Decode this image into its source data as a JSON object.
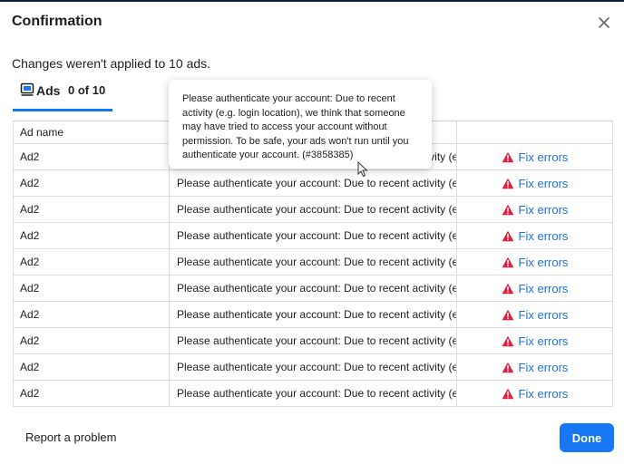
{
  "colors": {
    "accent": "#1877f2",
    "link": "#216fdb",
    "error": "#e41e3f",
    "header_band": "#0d1f33"
  },
  "dialog": {
    "title": "Confirmation",
    "close_icon": "close-icon",
    "subtitle": "Changes weren't applied to 10 ads."
  },
  "tab": {
    "icon": "ad-icon",
    "label": "Ads",
    "count": "0 of 10"
  },
  "table": {
    "columns": [
      "Ad name",
      "",
      ""
    ],
    "rows": [
      {
        "ad_name": "Ad2",
        "error": "Please authenticate your account: Due to recent activity (e.g...",
        "action": "Fix errors"
      },
      {
        "ad_name": "Ad2",
        "error": "Please authenticate your account: Due to recent activity (e.g...",
        "action": "Fix errors"
      },
      {
        "ad_name": "Ad2",
        "error": "Please authenticate your account: Due to recent activity (e.g...",
        "action": "Fix errors"
      },
      {
        "ad_name": "Ad2",
        "error": "Please authenticate your account: Due to recent activity (e.g...",
        "action": "Fix errors"
      },
      {
        "ad_name": "Ad2",
        "error": "Please authenticate your account: Due to recent activity (e.g...",
        "action": "Fix errors"
      },
      {
        "ad_name": "Ad2",
        "error": "Please authenticate your account: Due to recent activity (e.g...",
        "action": "Fix errors"
      },
      {
        "ad_name": "Ad2",
        "error": "Please authenticate your account: Due to recent activity (e.g...",
        "action": "Fix errors"
      },
      {
        "ad_name": "Ad2",
        "error": "Please authenticate your account: Due to recent activity (e.g...",
        "action": "Fix errors"
      },
      {
        "ad_name": "Ad2",
        "error": "Please authenticate your account: Due to recent activity (e.g...",
        "action": "Fix errors"
      },
      {
        "ad_name": "Ad2",
        "error": "Please authenticate your account: Due to recent activity (e.g...",
        "action": "Fix errors"
      }
    ]
  },
  "tooltip": {
    "text": "Please authenticate your account: Due to recent activity (e.g. login location), we think that someone may have tried to access your account without permission. To be safe, your ads won't run until you authenticate your account. (#3858385)"
  },
  "footer": {
    "report_label": "Report a problem",
    "done_label": "Done"
  }
}
